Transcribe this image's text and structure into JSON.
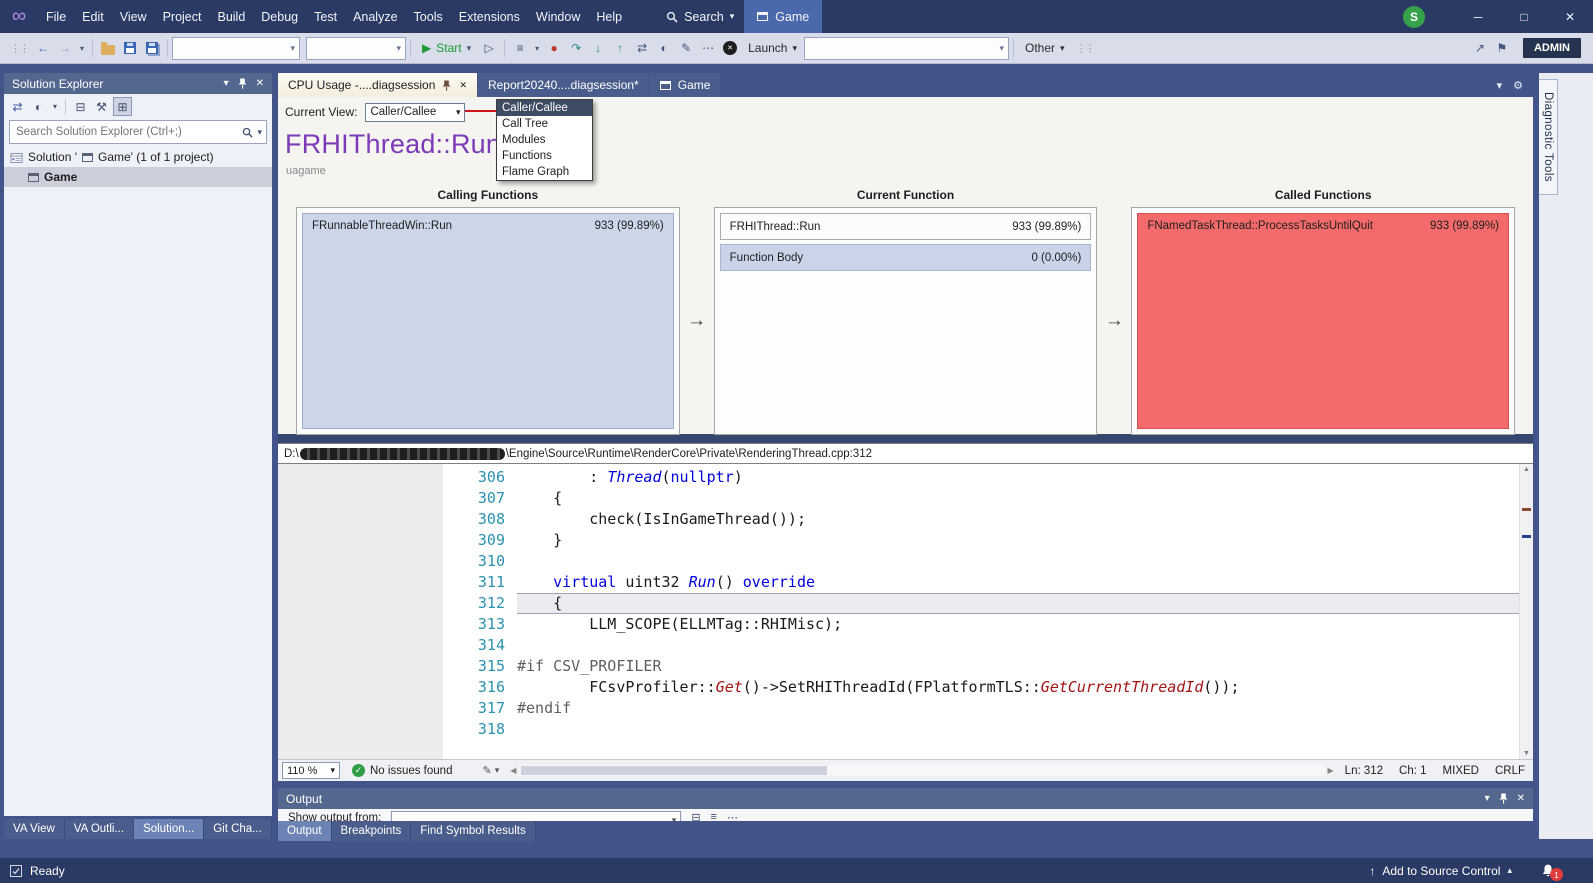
{
  "window": {
    "menus": [
      "File",
      "Edit",
      "View",
      "Project",
      "Build",
      "Debug",
      "Test",
      "Analyze",
      "Tools",
      "Extensions",
      "Window",
      "Help"
    ],
    "search_label": "Search",
    "target_label": "Game",
    "account_initial": "S"
  },
  "icons": {
    "infinity": "∞",
    "caret_down": "▾",
    "caret_up": "▴",
    "minimize": "─",
    "maximize": "□",
    "close": "✕",
    "back": "←",
    "forward": "→",
    "play": "▶",
    "play_outline": "▷",
    "menu_lines": "≡",
    "breakpoint_dot": "●",
    "step_over": "↷",
    "step_into": "↓",
    "step_out": "↑",
    "swap": "⇄",
    "half_circle": "◐",
    "edit_pen": "✎",
    "dots": "⋯",
    "grip": "⋮⋮",
    "arrow_flow": "→",
    "collapse_all": "⊟",
    "preview": "⊞",
    "wrench": "⚒",
    "gear": "⚙",
    "flag": "⚑",
    "share": "↗",
    "scroll_left": "◀",
    "scroll_right": "▶",
    "scroll_up": "▲",
    "scroll_down": "▼",
    "check": "✓",
    "up_arrow": "↑"
  },
  "toolbar": {
    "start_label": "Start",
    "launch_label": "Launch",
    "other_label": "Other",
    "admin_label": "ADMIN"
  },
  "solution_explorer": {
    "title": "Solution Explorer",
    "search_placeholder": "Search Solution Explorer (Ctrl+;)",
    "solution_prefix": "Solution '",
    "solution_suffix": "Game' (1 of 1 project)",
    "project_name": "Game",
    "bottom_tabs": [
      {
        "label": "VA View",
        "active": false
      },
      {
        "label": "VA Outli...",
        "active": false
      },
      {
        "label": "Solution...",
        "active": true
      },
      {
        "label": "Git Cha...",
        "active": false
      }
    ]
  },
  "doc_tabs": [
    {
      "label": "CPU Usage -....diagsession",
      "active": true
    },
    {
      "label": "Report20240....diagsession*",
      "active": false
    },
    {
      "label": "Game",
      "active": false,
      "icon": "window"
    }
  ],
  "profiler": {
    "current_view_label": "Current View:",
    "current_view_value": "Caller/Callee",
    "view_options": [
      "Caller/Callee",
      "Call Tree",
      "Modules",
      "Functions",
      "Flame Graph"
    ],
    "selected_option_index": 0,
    "function_title": "FRHIThread::Run",
    "module_name": "uagame",
    "columns": [
      {
        "header": "Calling Functions",
        "rows": [
          {
            "name": "FRunnableThreadWin::Run",
            "value": "933 (99.89%)"
          }
        ]
      },
      {
        "header": "Current Function",
        "rows": [
          {
            "name": "FRHIThread::Run",
            "value": "933 (99.89%)"
          },
          {
            "name": "Function Body",
            "value": "0 (0.00%)"
          }
        ]
      },
      {
        "header": "Called Functions",
        "rows": [
          {
            "name": "FNamedTaskThread::ProcessTasksUntilQuit",
            "value": "933 (99.89%)"
          }
        ]
      }
    ]
  },
  "source": {
    "path_drive": "D:\\",
    "path_rest": "\\Engine\\Source\\Runtime\\RenderCore\\Private\\RenderingThread.cpp:312",
    "zoom_level": "110 %",
    "issues_text": "No issues found",
    "line_status": "Ln: 312",
    "col_status": "Ch: 1",
    "encoding": "MIXED",
    "line_ending": "CRLF",
    "lines": [
      {
        "num": "306",
        "segs": [
          {
            "t": "        : ",
            "c": "p"
          },
          {
            "t": "Thread",
            "c": "t"
          },
          {
            "t": "(",
            "c": "p"
          },
          {
            "t": "nullptr",
            "c": "k"
          },
          {
            "t": ")",
            "c": "p"
          }
        ]
      },
      {
        "num": "307",
        "segs": [
          {
            "t": "    {",
            "c": "p"
          }
        ]
      },
      {
        "num": "308",
        "segs": [
          {
            "t": "        check(IsInGameThread());",
            "c": "p"
          }
        ]
      },
      {
        "num": "309",
        "segs": [
          {
            "t": "    }",
            "c": "p"
          }
        ]
      },
      {
        "num": "310",
        "segs": []
      },
      {
        "num": "311",
        "segs": [
          {
            "t": "    ",
            "c": "p"
          },
          {
            "t": "virtual",
            "c": "k"
          },
          {
            "t": " uint32 ",
            "c": "p"
          },
          {
            "t": "Run",
            "c": "t"
          },
          {
            "t": "() ",
            "c": "p"
          },
          {
            "t": "override",
            "c": "k"
          }
        ]
      },
      {
        "num": "312",
        "current": true,
        "segs": [
          {
            "t": "    {",
            "c": "p"
          }
        ]
      },
      {
        "num": "313",
        "segs": [
          {
            "t": "        LLM_SCOPE(ELLMTag::RHIMisc);",
            "c": "p"
          }
        ]
      },
      {
        "num": "314",
        "segs": []
      },
      {
        "num": "315",
        "segs": [
          {
            "t": "#if CSV_PROFILER",
            "c": "d"
          }
        ]
      },
      {
        "num": "316",
        "segs": [
          {
            "t": "        FCsvProfiler::",
            "c": "p"
          },
          {
            "t": "Get",
            "c": "m"
          },
          {
            "t": "()->SetRHIThreadId(FPlatformTLS::",
            "c": "p"
          },
          {
            "t": "GetCurrentThreadId",
            "c": "m"
          },
          {
            "t": "());",
            "c": "p"
          }
        ]
      },
      {
        "num": "317",
        "segs": [
          {
            "t": "#endif",
            "c": "d"
          }
        ]
      },
      {
        "num": "318",
        "segs": []
      }
    ]
  },
  "output": {
    "title": "Output",
    "show_from_label": "Show output from:",
    "tool_tabs": [
      {
        "label": "Output",
        "active": true
      },
      {
        "label": "Breakpoints",
        "active": false
      },
      {
        "label": "Find Symbol Results",
        "active": false
      }
    ]
  },
  "status_bar": {
    "ready": "Ready",
    "source_control": "Add to Source Control",
    "notification_count": "1"
  },
  "right_panel_tab": "Diagnostic Tools"
}
